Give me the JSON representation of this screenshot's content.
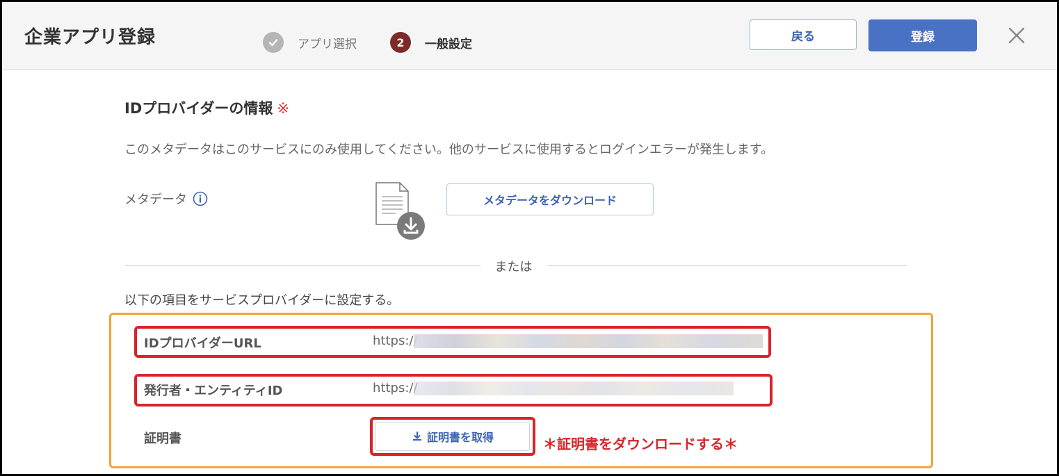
{
  "header": {
    "title": "企業アプリ登録",
    "steps": [
      {
        "label": "アプリ選択",
        "state": "done"
      },
      {
        "number": "2",
        "label": "一般設定",
        "state": "current"
      }
    ],
    "back_label": "戻る",
    "register_label": "登録",
    "close_icon": "close-icon"
  },
  "section": {
    "title": "IDプロバイダーの情報",
    "required_mark": "※",
    "description": "このメタデータはこのサービスにのみ使用してください。他のサービスに使用するとログインエラーが発生します。",
    "metadata_label": "メタデータ",
    "download_metadata_label": "メタデータをダウンロード",
    "or_label": "または",
    "setting_instruction": "以下の項目をサービスプロバイダーに設定する。"
  },
  "fields": {
    "idp_url": {
      "label": "IDプロバイダーURL",
      "value": "https://"
    },
    "issuer_id": {
      "label": "発行者・エンティティID",
      "value": "https://"
    },
    "certificate": {
      "label": "証明書",
      "button_label": "証明書を取得"
    }
  },
  "annotation": {
    "note": "＊証明書をダウンロードする＊"
  },
  "colors": {
    "accent": "#4a72c4",
    "link": "#3a63b3",
    "step_current": "#7d2a2a",
    "highlight_orange": "#f2a33a",
    "highlight_red": "#d9232a"
  }
}
